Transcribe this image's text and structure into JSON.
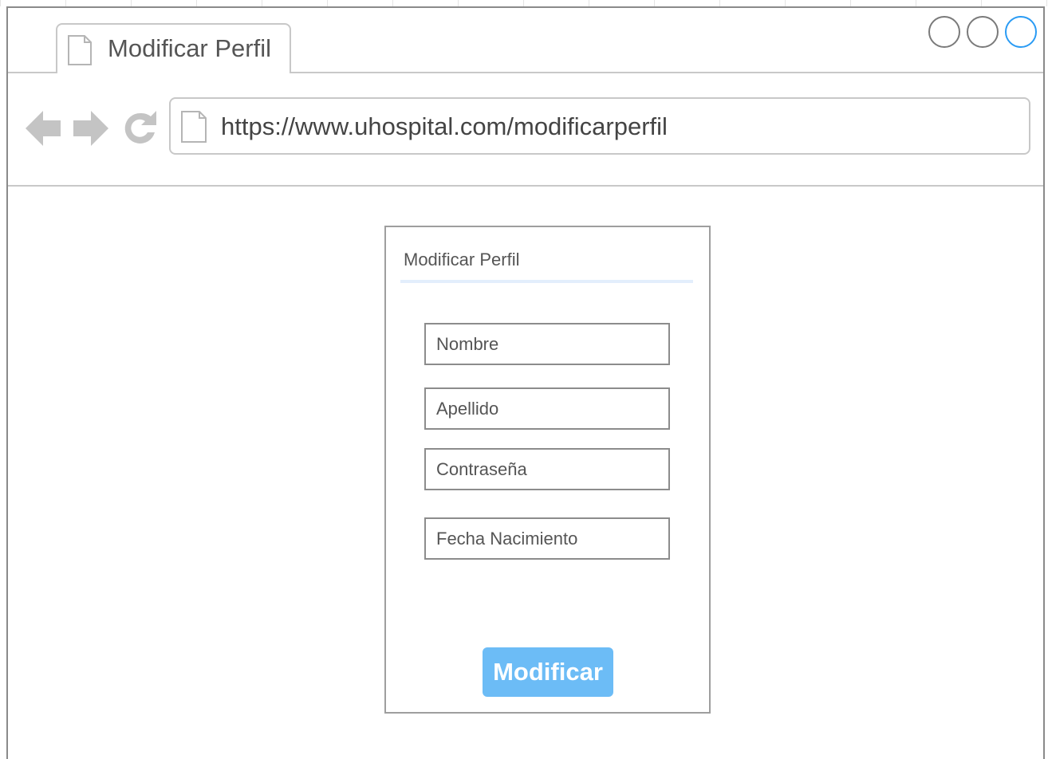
{
  "browser": {
    "tab_title": "Modificar Perfil",
    "url": "https://www.uhospital.com/modificarperfil",
    "window_controls": [
      "minimize",
      "maximize",
      "close"
    ],
    "active_control_color": "#2a9bf4"
  },
  "form": {
    "title": "Modificar Perfil",
    "fields": {
      "nombre_placeholder": "Nombre",
      "apellido_placeholder": "Apellido",
      "contrasena_placeholder": "Contraseña",
      "fecha_placeholder": "Fecha Nacimiento"
    },
    "submit_label": "Modificar",
    "submit_color": "#6cbcf6"
  },
  "icons": {
    "tab": "page-icon",
    "back": "arrow-left-icon",
    "forward": "arrow-right-icon",
    "reload": "reload-icon",
    "url": "page-icon"
  }
}
